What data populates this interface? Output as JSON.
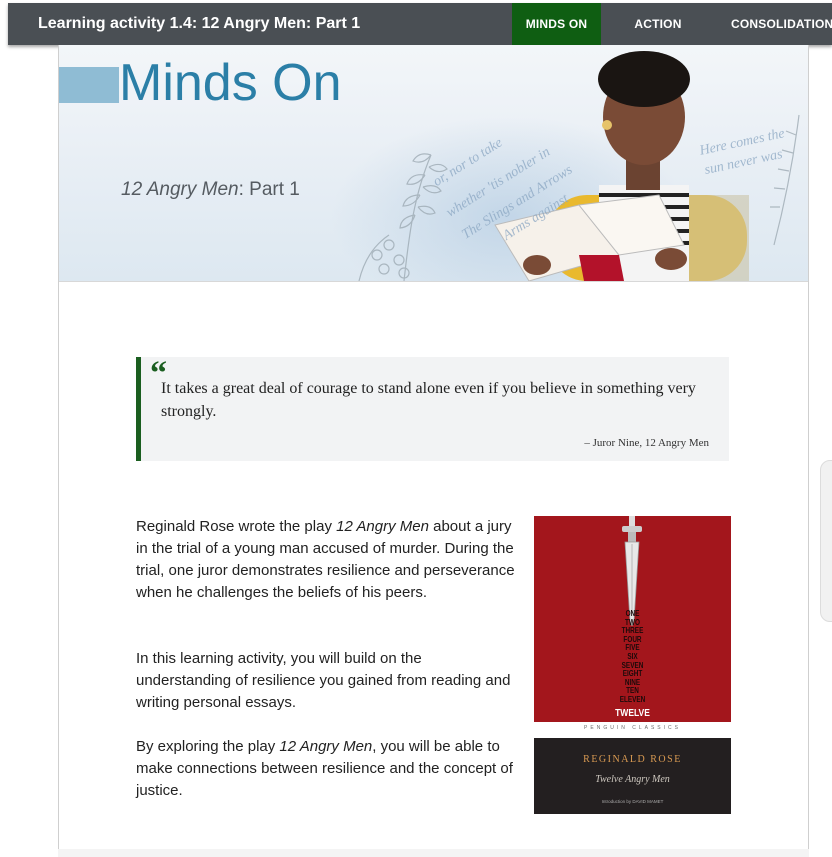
{
  "header": {
    "title": "Learning activity 1.4: 12 Angry Men: Part 1",
    "tabs": [
      {
        "label": "MINDS ON",
        "active": true
      },
      {
        "label": "ACTION",
        "active": false
      },
      {
        "label": "CONSOLIDATION",
        "active": false
      }
    ]
  },
  "banner": {
    "heading": "Minds On",
    "subtitle_italic": "12 Angry Men",
    "subtitle_rest": ": Part 1"
  },
  "quote": {
    "text": "It takes a great deal of courage to stand alone even if you believe in something very strongly.",
    "attribution": "– Juror Nine, 12 Angry Men"
  },
  "content": {
    "p1_before": "Reginald Rose wrote the play ",
    "p1_italic": "12 Angry Men",
    "p1_after": " about a jury in the trial of a young man accused of murder. During the trial, one juror demonstrates resilience and perseverance when he challenges the beliefs of his peers.",
    "p2": "In this learning activity, you will build on the understanding of resilience you gained from reading and writing personal essays.",
    "p3_before": "By exploring the play ",
    "p3_italic": "12 Angry Men",
    "p3_after": ", you will be able to make connections between resilience and the concept of justice."
  },
  "book_cover": {
    "count_words": [
      "ONE",
      "TWO",
      "THREE",
      "FOUR",
      "FIVE",
      "SIX",
      "SEVEN",
      "EIGHT",
      "NINE",
      "TEN",
      "ELEVEN"
    ],
    "twelve": "TWELVE",
    "publisher_line": "PENGUIN   CLASSICS",
    "author": "REGINALD ROSE",
    "title": "Twelve Angry Men",
    "intro": "Introduction by DAVID MAMET"
  },
  "colors": {
    "topbar": "#4a4f54",
    "active_tab": "#0f5e12",
    "heading_blue": "#2b7fa7",
    "quote_rule": "#1b5e20",
    "cover_red": "#a3161c"
  }
}
